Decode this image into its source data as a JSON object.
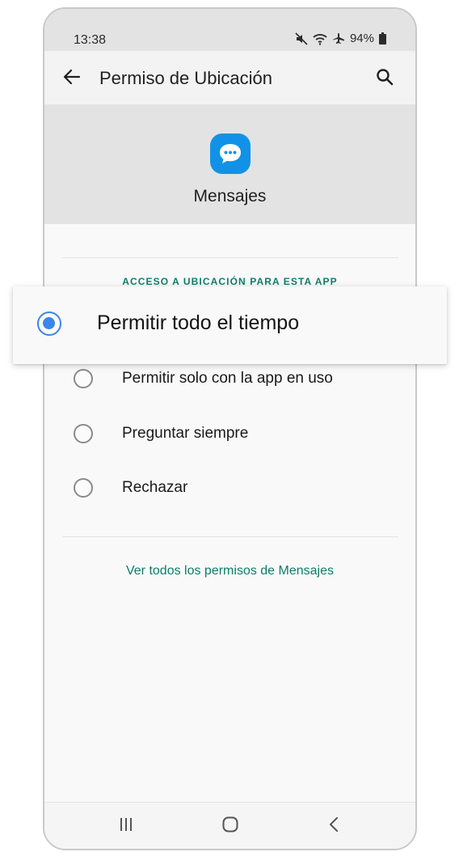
{
  "status_bar": {
    "time": "13:38",
    "battery": "94%",
    "icons": [
      "mute-icon",
      "wifi-icon",
      "airplane-icon",
      "battery-icon"
    ]
  },
  "app_bar": {
    "title": "Permiso de Ubicación",
    "back_icon": "arrow-left-icon",
    "search_icon": "search-icon"
  },
  "app_header": {
    "app_name": "Mensajes",
    "icon": "message-bubble-icon",
    "icon_color": "#1292e6"
  },
  "section": {
    "label": "ACCESO A UBICACIÓN PARA ESTA APP"
  },
  "options": [
    {
      "label": "Permitir todo el tiempo",
      "selected": true
    },
    {
      "label": "Permitir solo con la app en uso",
      "selected": false
    },
    {
      "label": "Preguntar siempre",
      "selected": false
    },
    {
      "label": "Rechazar",
      "selected": false
    }
  ],
  "link": {
    "label": "Ver todos los permisos de Mensajes"
  },
  "nav_bar": {
    "icons": [
      "recents-icon",
      "home-icon",
      "back-icon"
    ]
  },
  "colors": {
    "accent": "#0b7d6c",
    "radio_selected": "#3a86e8"
  }
}
